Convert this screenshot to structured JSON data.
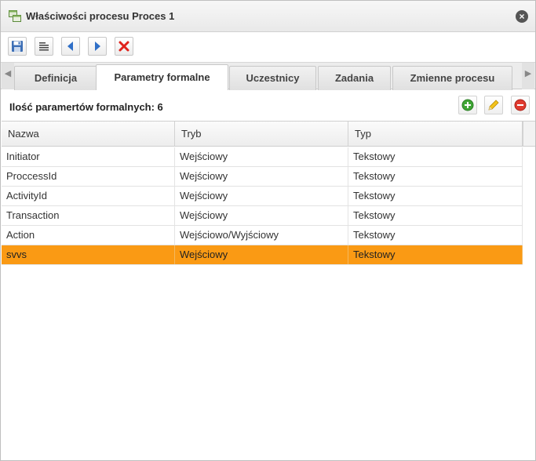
{
  "window": {
    "title": "Właściwości procesu Proces 1",
    "close_symbol": "×"
  },
  "toolbar": {
    "buttons": [
      {
        "icon": "save-icon"
      },
      {
        "icon": "text-format-icon"
      },
      {
        "icon": "arrow-left-icon"
      },
      {
        "icon": "arrow-right-icon"
      },
      {
        "icon": "delete-icon"
      }
    ]
  },
  "tabs": {
    "scroll_left": "◀",
    "scroll_right": "▶",
    "items": [
      {
        "label": "Definicja",
        "active": false
      },
      {
        "label": "Parametry formalne",
        "active": true
      },
      {
        "label": "Uczestnicy",
        "active": false
      },
      {
        "label": "Zadania",
        "active": false
      },
      {
        "label": "Zmienne procesu",
        "active": false
      }
    ]
  },
  "section": {
    "count_label": "Ilość paramertów formalnych: 6",
    "actions": [
      {
        "icon": "add-icon",
        "color": "#3fa535"
      },
      {
        "icon": "edit-icon",
        "color": "#f0b400"
      },
      {
        "icon": "remove-icon",
        "color": "#e03a2f"
      }
    ]
  },
  "grid": {
    "columns": [
      "Nazwa",
      "Tryb",
      "Typ"
    ],
    "rows": [
      {
        "nazwa": "Initiator",
        "tryb": "Wejściowy",
        "typ": "Tekstowy",
        "selected": false
      },
      {
        "nazwa": "ProccessId",
        "tryb": "Wejściowy",
        "typ": "Tekstowy",
        "selected": false
      },
      {
        "nazwa": "ActivityId",
        "tryb": "Wejściowy",
        "typ": "Tekstowy",
        "selected": false
      },
      {
        "nazwa": "Transaction",
        "tryb": "Wejściowy",
        "typ": "Tekstowy",
        "selected": false
      },
      {
        "nazwa": "Action",
        "tryb": "Wejściowo/Wyjściowy",
        "typ": "Tekstowy",
        "selected": false
      },
      {
        "nazwa": "svvs",
        "tryb": "Wejściowy",
        "typ": "Tekstowy",
        "selected": true
      }
    ],
    "selection_color": "#fa9a14"
  }
}
